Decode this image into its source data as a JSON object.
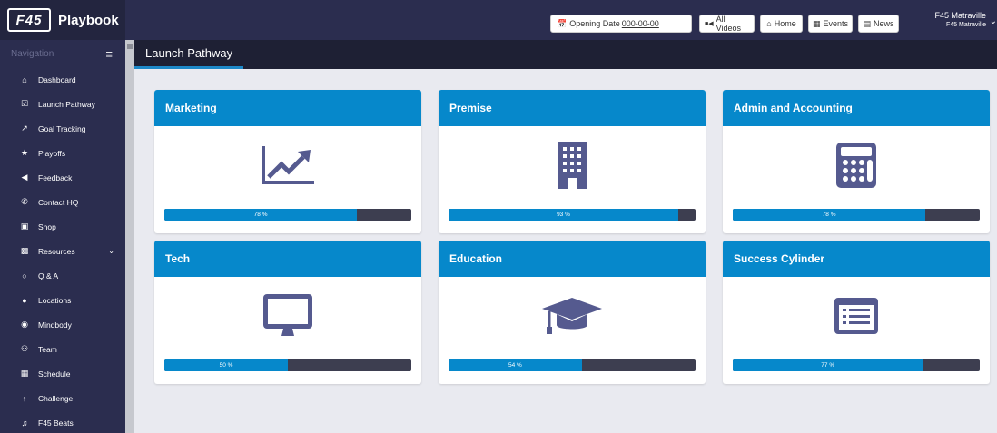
{
  "header": {
    "brand_title": "Playbook",
    "logo_text": "F45",
    "opening_date_label": "Opening Date",
    "opening_date_value": "000-00-00",
    "buttons": {
      "all_videos": "All Videos",
      "home": "Home",
      "events": "Events",
      "news": "News"
    },
    "user_name": "F45 Matraville",
    "user_location": "F45 Matraville"
  },
  "sidebar": {
    "title": "Navigation",
    "items": [
      {
        "label": "Dashboard",
        "icon": "home-icon"
      },
      {
        "label": "Launch Pathway",
        "icon": "checkbox-icon"
      },
      {
        "label": "Goal Tracking",
        "icon": "line-chart-icon"
      },
      {
        "label": "Playoffs",
        "icon": "trophy-icon"
      },
      {
        "label": "Feedback",
        "icon": "bullhorn-icon"
      },
      {
        "label": "Contact HQ",
        "icon": "phone-icon"
      },
      {
        "label": "Shop",
        "icon": "cart-icon"
      },
      {
        "label": "Resources",
        "icon": "cubes-icon"
      },
      {
        "label": "Q & A",
        "icon": "chat-icon"
      },
      {
        "label": "Locations",
        "icon": "map-pin-icon"
      },
      {
        "label": "Mindbody",
        "icon": "eye-icon"
      },
      {
        "label": "Team",
        "icon": "team-icon"
      },
      {
        "label": "Schedule",
        "icon": "calendar-icon"
      },
      {
        "label": "Challenge",
        "icon": "person-icon"
      },
      {
        "label": "F45 Beats",
        "icon": "music-icon"
      }
    ]
  },
  "main": {
    "title": "Launch Pathway",
    "accent_color": "#0688cb",
    "cards": [
      {
        "title": "Marketing",
        "icon": "line-chart-icon",
        "progress": 78,
        "progress_text": "78 %"
      },
      {
        "title": "Premise",
        "icon": "building-icon",
        "progress": 93,
        "progress_text": "93 %"
      },
      {
        "title": "Admin and Accounting",
        "icon": "calculator-icon",
        "progress": 78,
        "progress_text": "78 %"
      },
      {
        "title": "Tech",
        "icon": "monitor-icon",
        "progress": 50,
        "progress_text": "50 %"
      },
      {
        "title": "Education",
        "icon": "graduation-cap-icon",
        "progress": 54,
        "progress_text": "54 %"
      },
      {
        "title": "Success Cylinder",
        "icon": "list-icon",
        "progress": 77,
        "progress_text": "77 %"
      }
    ]
  }
}
